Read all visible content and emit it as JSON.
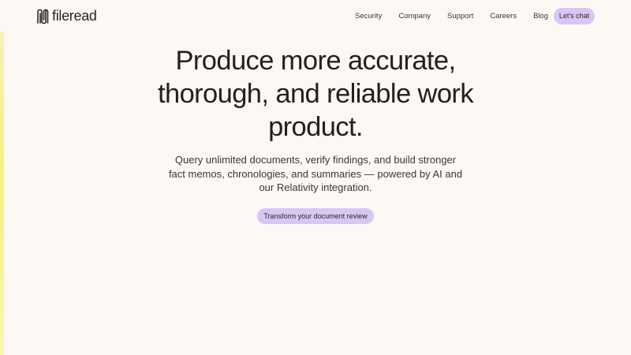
{
  "brand": {
    "name": "fileread",
    "logo_icon": "fileread-logo-icon"
  },
  "nav": {
    "links": [
      {
        "label": "Security"
      },
      {
        "label": "Company"
      },
      {
        "label": "Support"
      },
      {
        "label": "Careers"
      },
      {
        "label": "Blog"
      }
    ],
    "cta_label": "Let's chat"
  },
  "hero": {
    "headline": "Produce more accurate, thorough, and reliable work product.",
    "subheadline": "Query unlimited documents, verify findings, and build stronger fact memos, chronologies, and summaries — powered by AI and our Relativity integration.",
    "cta_label": "Transform your document review"
  },
  "colors": {
    "background": "#fcf9f4",
    "accent_button": "#d8c6f5",
    "text": "#2a2622",
    "side_accent": "#f3f37a"
  }
}
